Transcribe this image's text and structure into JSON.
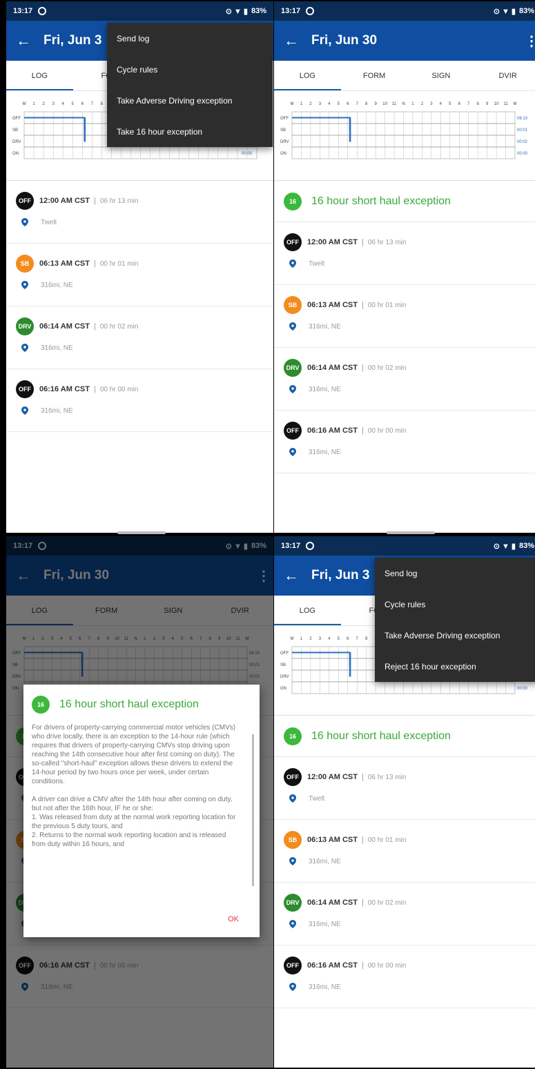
{
  "status": {
    "time": "13:17",
    "battery": "83%"
  },
  "appbar": {
    "title": "Fri, Jun 30",
    "title_short": "Fri, Jun 3"
  },
  "tabs": [
    "LOG",
    "FORM",
    "SIGN",
    "DVIR"
  ],
  "tab_short": "FO",
  "chart_data": {
    "type": "table",
    "hours": [
      "M",
      "1",
      "2",
      "3",
      "4",
      "5",
      "6",
      "7",
      "8",
      "9",
      "10",
      "11",
      "N",
      "1",
      "2",
      "3",
      "4",
      "5",
      "6",
      "7",
      "8",
      "9",
      "10",
      "11",
      "M"
    ],
    "rows": [
      "OFF",
      "SB",
      "DRV",
      "ON"
    ],
    "totals": [
      "06:13",
      "00:01",
      "00:02",
      "00:00"
    ],
    "segments": [
      {
        "status": "OFF",
        "start": 0,
        "end": 6.22
      },
      {
        "status": "SB",
        "start": 6.22,
        "end": 6.23
      },
      {
        "status": "DRV",
        "start": 6.23,
        "end": 6.27
      },
      {
        "status": "OFF",
        "start": 6.27,
        "end": 6.27
      }
    ]
  },
  "exception": {
    "badge": "16",
    "title": "16 hour short haul exception"
  },
  "entries": [
    {
      "status": "OFF",
      "color": "#111111",
      "time": "12:00 AM CST",
      "duration": "06 hr 13 min",
      "location": "Twelt"
    },
    {
      "status": "SB",
      "color": "#f28c1e",
      "time": "06:13 AM CST",
      "duration": "00 hr 01 min",
      "location": "316mi, NE"
    },
    {
      "status": "DRV",
      "color": "#2e8b2e",
      "time": "06:14 AM CST",
      "duration": "00 hr 02 min",
      "location": "316mi, NE"
    },
    {
      "status": "OFF",
      "color": "#111111",
      "time": "06:16 AM CST",
      "duration": "00 hr 00 min",
      "location": "316mi, NE"
    }
  ],
  "menu1": [
    "Send log",
    "Cycle rules",
    "Take Adverse Driving exception",
    "Take 16 hour exception"
  ],
  "menu2": [
    "Send log",
    "Cycle rules",
    "Take Adverse Driving exception",
    "Reject 16 hour exception"
  ],
  "dialog": {
    "title": "16 hour short haul exception",
    "p1": "For drivers of property-carrying commercial motor vehicles (CMVs) who drive locally, there is an exception to the 14-hour rule (which requires that drivers of property-carrying CMVs stop driving upon reaching the 14th consecutive hour after first coming on duty). The so-called \"short-haul\" exception allows these drivers to extend the 14-hour period by two hours once per week, under certain conditions.",
    "p2": "A driver can drive a CMV after the 14th hour after coming on duty, but not after the 16th hour, IF he or she:",
    "p3": "1. Was released from duty at the normal work reporting location for the previous 5 duty tours, and",
    "p4": "2. Returns to the normal work reporting location and is released from duty within 16 hours, and",
    "ok": "OK"
  },
  "colors": {
    "appbar": "#0f4ea0",
    "statusbar": "#0b2d55",
    "exception": "#3aa83a",
    "chart_line": "#2a6fc0"
  }
}
